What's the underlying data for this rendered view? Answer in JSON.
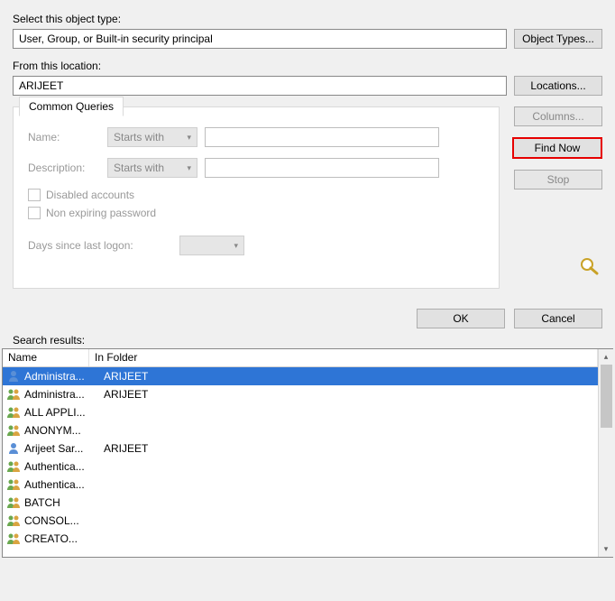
{
  "objectType": {
    "label": "Select this object type:",
    "value": "User, Group, or Built-in security principal",
    "button": "Object Types..."
  },
  "location": {
    "label": "From this location:",
    "value": "ARIJEET",
    "button": "Locations..."
  },
  "queries": {
    "tab": "Common Queries",
    "nameLabel": "Name:",
    "nameMode": "Starts with",
    "descLabel": "Description:",
    "descMode": "Starts with",
    "disabled": "Disabled accounts",
    "nonexpiring": "Non expiring password",
    "daysLabel": "Days since last logon:"
  },
  "sideButtons": {
    "columns": "Columns...",
    "findNow": "Find Now",
    "stop": "Stop"
  },
  "dialogButtons": {
    "ok": "OK",
    "cancel": "Cancel"
  },
  "results": {
    "label": "Search results:",
    "columns": {
      "name": "Name",
      "folder": "In Folder"
    },
    "rows": [
      {
        "name": "Administra...",
        "folder": "ARIJEET",
        "icon": "user",
        "selected": true
      },
      {
        "name": "Administra...",
        "folder": "ARIJEET",
        "icon": "group",
        "selected": false
      },
      {
        "name": "ALL APPLI...",
        "folder": "",
        "icon": "group",
        "selected": false
      },
      {
        "name": "ANONYM...",
        "folder": "",
        "icon": "group",
        "selected": false
      },
      {
        "name": "Arijeet Sar...",
        "folder": "ARIJEET",
        "icon": "user",
        "selected": false
      },
      {
        "name": "Authentica...",
        "folder": "",
        "icon": "group",
        "selected": false
      },
      {
        "name": "Authentica...",
        "folder": "",
        "icon": "group",
        "selected": false
      },
      {
        "name": "BATCH",
        "folder": "",
        "icon": "group",
        "selected": false
      },
      {
        "name": "CONSOL...",
        "folder": "",
        "icon": "group",
        "selected": false
      },
      {
        "name": "CREATO...",
        "folder": "",
        "icon": "group",
        "selected": false
      }
    ]
  }
}
